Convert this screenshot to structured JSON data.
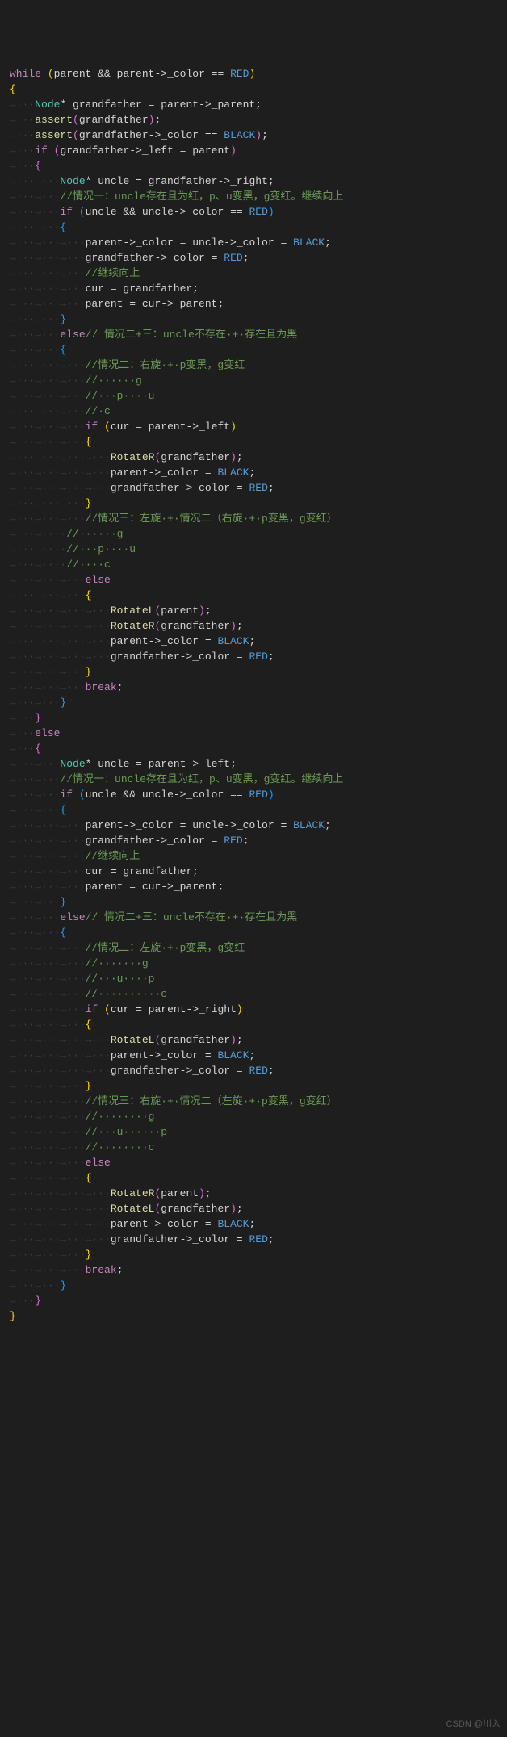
{
  "watermark": "CSDN @川入",
  "code": {
    "while_kw": "while",
    "parent": "parent",
    "color_mem": "_color",
    "red": "RED",
    "black": "BLACK",
    "node_type": "Node",
    "grandfather": "grandfather",
    "uncle": "uncle",
    "cur": "cur",
    "parent_mem": "_parent",
    "left_mem": "_left",
    "right_mem": "_right",
    "assert_fn": "assert",
    "if_kw": "if",
    "else_kw": "else",
    "break_kw": "break",
    "rotateR": "RotateR",
    "rotateL": "RotateL",
    "comment_case1_top": "//情况一：uncle存在且为红，p、u变黑，g变红。继续向上",
    "comment_continue": "//继续向上",
    "comment_else23": "// 情况二+三：uncle不存在·+·存在且为黑",
    "comment_case2_right": "//情况二：右旋·+·p变黑，g变红",
    "comment_g": "//······g",
    "comment_pu": "//···p····u",
    "comment_c": "//·c",
    "comment_case3_left": "//情况三：左旋·+·情况二（右旋·+·p变黑，g变红）",
    "comment_g2": "//······g",
    "comment_pu2": "//···p····u",
    "comment_c2": "//····c",
    "comment_case2_left": "//情况二：左旋·+·p变黑，g变红",
    "comment_g3": "//·······g",
    "comment_up": "//···u····p",
    "comment_c3": "//··········c",
    "comment_case3_right": "//情况三：右旋·+·情况二（左旋·+·p变黑，g变红）",
    "comment_g4": "//········g",
    "comment_up2": "//···u······p",
    "comment_c4": "//········c",
    "arrow_indent1": "→···",
    "arrow_indent2": "→···→···",
    "arrow_indent3": "→···→···→···",
    "arrow_indent4": "→···→···→···→···"
  }
}
